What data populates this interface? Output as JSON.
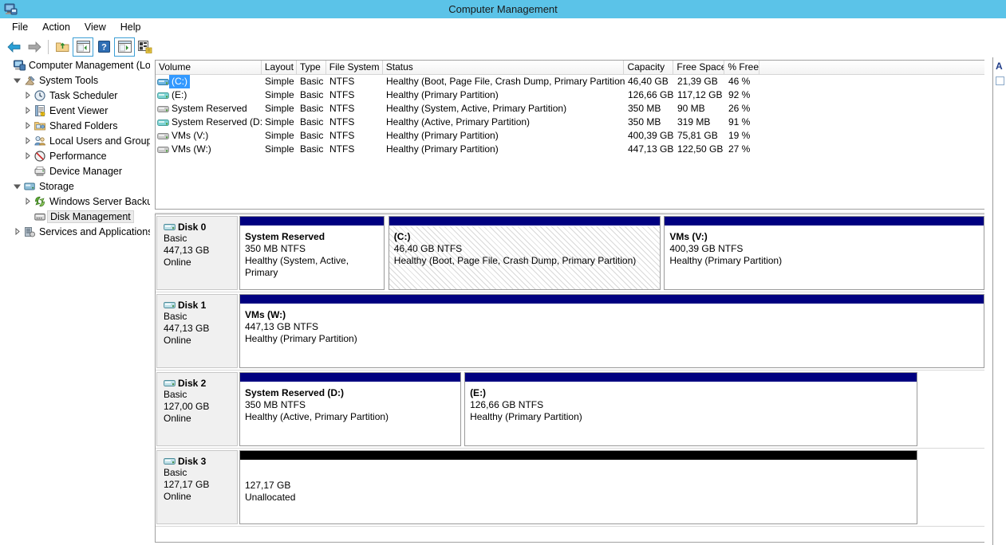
{
  "window": {
    "title": "Computer Management",
    "icon": "computer-management-icon",
    "titlebar_color": "#5bc3e8"
  },
  "menu": {
    "items": [
      {
        "label": "File"
      },
      {
        "label": "Action"
      },
      {
        "label": "View"
      },
      {
        "label": "Help"
      }
    ]
  },
  "toolbar": {
    "buttons": [
      {
        "name": "back-button",
        "icon": "back-arrow-icon"
      },
      {
        "name": "forward-button",
        "icon": "forward-arrow-icon"
      },
      {
        "name": "up-one-level-button",
        "icon": "folder-up-icon"
      },
      {
        "name": "show-hide-console-tree-button",
        "icon": "console-tree-icon",
        "framed": true
      },
      {
        "name": "help-button",
        "icon": "question-mark-icon"
      },
      {
        "name": "show-hide-action-pane-button",
        "icon": "action-pane-icon",
        "framed": true
      },
      {
        "name": "rescan-disks-button",
        "icon": "rescan-disks-icon"
      }
    ]
  },
  "tree": {
    "items": [
      {
        "label": "Computer Management (Local",
        "indent": 0,
        "twist": "",
        "icon": "computer-icon",
        "selected": false
      },
      {
        "label": "System Tools",
        "indent": 1,
        "twist": "expanded",
        "icon": "system-tools-icon",
        "selected": false
      },
      {
        "label": "Task Scheduler",
        "indent": 2,
        "twist": "collapsed",
        "icon": "clock-icon",
        "selected": false
      },
      {
        "label": "Event Viewer",
        "indent": 2,
        "twist": "collapsed",
        "icon": "event-viewer-icon",
        "selected": false
      },
      {
        "label": "Shared Folders",
        "indent": 2,
        "twist": "collapsed",
        "icon": "shared-folders-icon",
        "selected": false
      },
      {
        "label": "Local Users and Groups",
        "indent": 2,
        "twist": "collapsed",
        "icon": "users-icon",
        "selected": false
      },
      {
        "label": "Performance",
        "indent": 2,
        "twist": "collapsed",
        "icon": "performance-icon",
        "selected": false
      },
      {
        "label": "Device Manager",
        "indent": 2,
        "twist": "",
        "icon": "device-manager-icon",
        "selected": false
      },
      {
        "label": "Storage",
        "indent": 1,
        "twist": "expanded",
        "icon": "storage-icon",
        "selected": false
      },
      {
        "label": "Windows Server Backup",
        "indent": 2,
        "twist": "collapsed",
        "icon": "backup-icon",
        "selected": false
      },
      {
        "label": "Disk Management",
        "indent": 2,
        "twist": "",
        "icon": "disk-management-icon",
        "selected": true
      },
      {
        "label": "Services and Applications",
        "indent": 1,
        "twist": "collapsed",
        "icon": "services-icon",
        "selected": false
      }
    ]
  },
  "volume_list": {
    "columns": [
      {
        "label": "Volume",
        "class": "c-vol"
      },
      {
        "label": "Layout",
        "class": "c-lay"
      },
      {
        "label": "Type",
        "class": "c-typ"
      },
      {
        "label": "File System",
        "class": "c-fs"
      },
      {
        "label": "Status",
        "class": "c-sta"
      },
      {
        "label": "Capacity",
        "class": "c-cap"
      },
      {
        "label": "Free Space",
        "class": "c-free"
      },
      {
        "label": "% Free",
        "class": "c-pct"
      },
      {
        "label": "",
        "class": "c-last"
      }
    ],
    "rows": [
      {
        "volume": "(C:)",
        "icon": "volume-blue-icon",
        "selected": true,
        "layout": "Simple",
        "type": "Basic",
        "file_system": "NTFS",
        "status": "Healthy (Boot, Page File, Crash Dump, Primary Partition)",
        "capacity": "46,40 GB",
        "free_space": "21,39 GB",
        "percent_free": "46 %"
      },
      {
        "volume": "(E:)",
        "icon": "volume-teal-icon",
        "selected": false,
        "layout": "Simple",
        "type": "Basic",
        "file_system": "NTFS",
        "status": "Healthy (Primary Partition)",
        "capacity": "126,66 GB",
        "free_space": "117,12 GB",
        "percent_free": "92 %"
      },
      {
        "volume": "System Reserved",
        "icon": "volume-gray-icon",
        "selected": false,
        "layout": "Simple",
        "type": "Basic",
        "file_system": "NTFS",
        "status": "Healthy (System, Active, Primary Partition)",
        "capacity": "350 MB",
        "free_space": "90 MB",
        "percent_free": "26 %"
      },
      {
        "volume": "System Reserved (D:)",
        "icon": "volume-teal-icon",
        "selected": false,
        "layout": "Simple",
        "type": "Basic",
        "file_system": "NTFS",
        "status": "Healthy (Active, Primary Partition)",
        "capacity": "350 MB",
        "free_space": "319 MB",
        "percent_free": "91 %"
      },
      {
        "volume": "VMs (V:)",
        "icon": "volume-gray-icon",
        "selected": false,
        "layout": "Simple",
        "type": "Basic",
        "file_system": "NTFS",
        "status": "Healthy (Primary Partition)",
        "capacity": "400,39 GB",
        "free_space": "75,81 GB",
        "percent_free": "19 %"
      },
      {
        "volume": "VMs (W:)",
        "icon": "volume-gray-icon",
        "selected": false,
        "layout": "Simple",
        "type": "Basic",
        "file_system": "NTFS",
        "status": "Healthy (Primary Partition)",
        "capacity": "447,13 GB",
        "free_space": "122,50 GB",
        "percent_free": "27 %"
      }
    ]
  },
  "disk_graphic": {
    "disks": [
      {
        "name": "Disk 0",
        "type": "Basic",
        "capacity": "447,13 GB",
        "state": "Online",
        "partitions": [
          {
            "title": "System Reserved",
            "size": "350 MB NTFS",
            "status": "Healthy (System, Active, Primary",
            "left_pct": 0.0,
            "width_pct": 19.5,
            "unallocated": false,
            "selected": false
          },
          {
            "title": "(C:)",
            "size": "46,40 GB NTFS",
            "status": "Healthy (Boot, Page File, Crash Dump, Primary Partition)",
            "left_pct": 20.0,
            "width_pct": 36.5,
            "unallocated": false,
            "selected": true
          },
          {
            "title": "VMs  (V:)",
            "size": "400,39 GB NTFS",
            "status": "Healthy (Primary Partition)",
            "left_pct": 57.0,
            "width_pct": 43.0,
            "unallocated": false,
            "selected": false
          }
        ]
      },
      {
        "name": "Disk 1",
        "type": "Basic",
        "capacity": "447,13 GB",
        "state": "Online",
        "partitions": [
          {
            "title": "VMs  (W:)",
            "size": "447,13 GB NTFS",
            "status": "Healthy (Primary Partition)",
            "left_pct": 0.0,
            "width_pct": 100.0,
            "unallocated": false,
            "selected": false
          }
        ]
      },
      {
        "name": "Disk 2",
        "type": "Basic",
        "capacity": "127,00 GB",
        "state": "Online",
        "partitions": [
          {
            "title": "System Reserved  (D:)",
            "size": "350 MB NTFS",
            "status": "Healthy (Active, Primary Partition)",
            "left_pct": 0.0,
            "width_pct": 29.8,
            "unallocated": false,
            "selected": false
          },
          {
            "title": "(E:)",
            "size": "126,66 GB NTFS",
            "status": "Healthy (Primary Partition)",
            "left_pct": 30.2,
            "width_pct": 60.8,
            "unallocated": false,
            "selected": false
          }
        ]
      },
      {
        "name": "Disk 3",
        "type": "Basic",
        "capacity": "127,17 GB",
        "state": "Online",
        "partitions": [
          {
            "title": "",
            "size": "127,17 GB",
            "status": "Unallocated",
            "left_pct": 0.0,
            "width_pct": 91.0,
            "unallocated": true,
            "selected": false
          }
        ]
      }
    ]
  },
  "actions_pane": {
    "title": "A"
  }
}
